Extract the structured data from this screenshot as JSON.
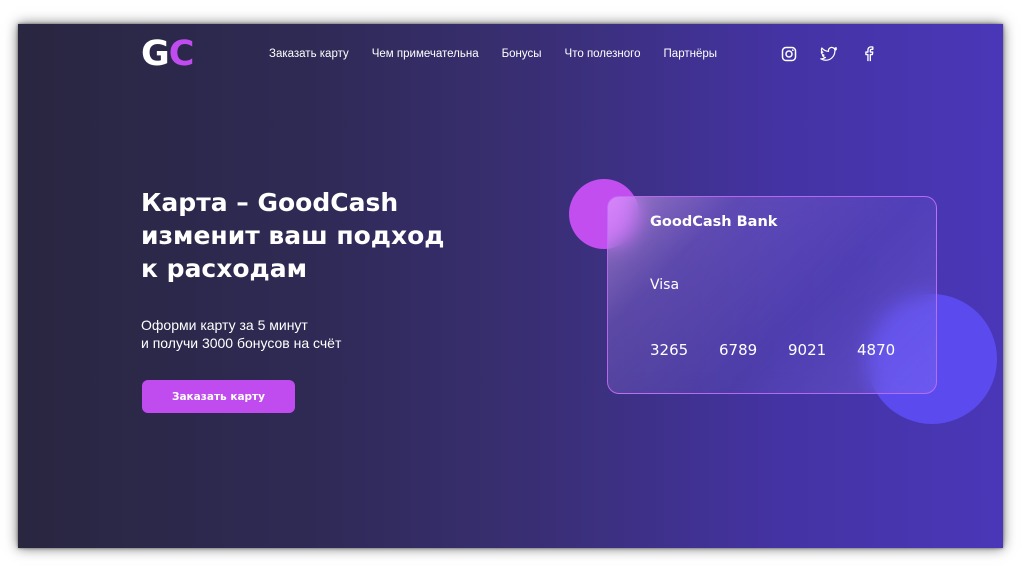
{
  "brand": {
    "logo_g": "G",
    "logo_c": "C",
    "accent_color": "#c04cf0"
  },
  "nav": {
    "items": [
      {
        "label": "Заказать карту"
      },
      {
        "label": "Чем примечательна"
      },
      {
        "label": "Бонусы"
      },
      {
        "label": "Что полезного"
      },
      {
        "label": "Партнёры"
      }
    ]
  },
  "social": {
    "icons": [
      "instagram-icon",
      "twitter-icon",
      "facebook-icon"
    ]
  },
  "hero": {
    "headline_lines": [
      "Карта – GoodCash",
      "изменит ваш подход",
      "к расходам"
    ],
    "subtext_lines": [
      "Оформи карту за 5 минут",
      "и получи 3000 бонусов на счёт"
    ],
    "cta_label": "Заказать карту"
  },
  "card": {
    "bank_name": "GoodCash Bank",
    "type": "Visa",
    "number_groups": [
      "3265",
      "6789",
      "9021",
      "4870"
    ]
  }
}
